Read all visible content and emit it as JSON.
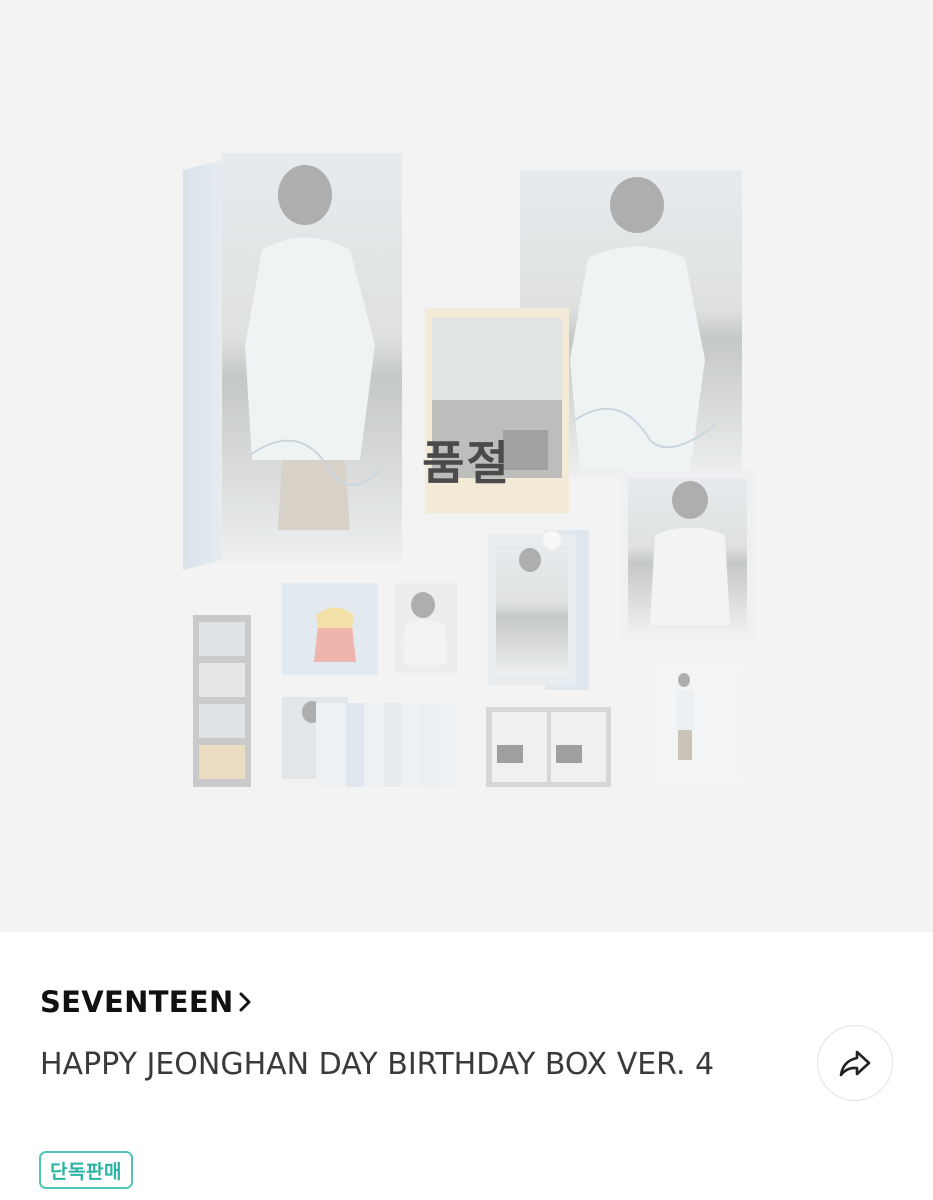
{
  "product": {
    "image_overlay_label": "품절",
    "brand": "SEVENTEEN",
    "title": "HAPPY JEONGHAN DAY BIRTHDAY BOX VER. 4",
    "badge": "단독판매"
  },
  "icons": {
    "brand_chevron": "chevron-right-icon",
    "share": "share-arrow-icon"
  },
  "colors": {
    "hero_background": "#f3f3f3",
    "badge_accent": "#2bb3a3",
    "text_primary": "#111111",
    "text_secondary": "#3a3a3a"
  }
}
